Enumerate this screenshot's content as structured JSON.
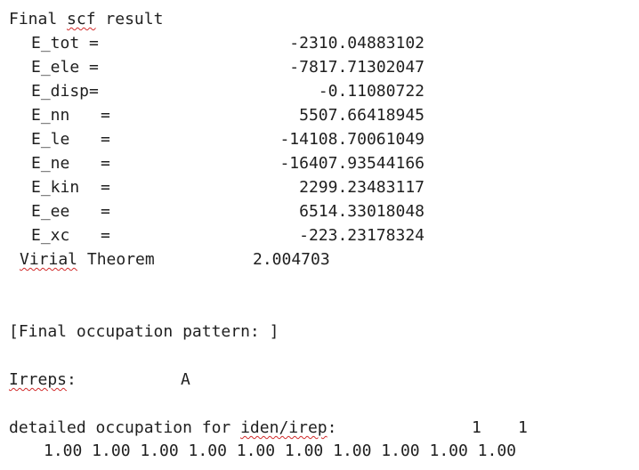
{
  "header": {
    "word1": "Final",
    "word2": "scf",
    "word3": "result"
  },
  "energies": [
    {
      "label": "E_tot =",
      "value": "-2310.04883102"
    },
    {
      "label": "E_ele =",
      "value": "-7817.71302047"
    },
    {
      "label": "E_disp=",
      "value": "-0.11080722"
    },
    {
      "label": "E_nn",
      "eq": "=",
      "value": "5507.66418945"
    },
    {
      "label": "E_le",
      "eq": "=",
      "value": "-14108.70061049"
    },
    {
      "label": "E_ne",
      "eq": "=",
      "value": "-16407.93544166"
    },
    {
      "label": "E_kin",
      "eq": "=",
      "value": "2299.23483117"
    },
    {
      "label": "E_ee",
      "eq": "=",
      "value": "6514.33018048"
    },
    {
      "label": "E_xc",
      "eq": "=",
      "value": "-223.23178324"
    }
  ],
  "virial": {
    "word1": "Virial",
    "word2": "Theorem",
    "value": "2.004703"
  },
  "occupation_header": "[Final occupation pattern: ]",
  "irreps": {
    "label": "Irreps:",
    "colon": ":",
    "word": "Irreps",
    "value": "A"
  },
  "detailed": {
    "prefix": "detailed occupation for ",
    "word": "iden/irep",
    "suffix": ":",
    "n1": "1",
    "n2": "1",
    "values": "1.00 1.00 1.00 1.00 1.00 1.00 1.00 1.00 1.00 1.00"
  }
}
